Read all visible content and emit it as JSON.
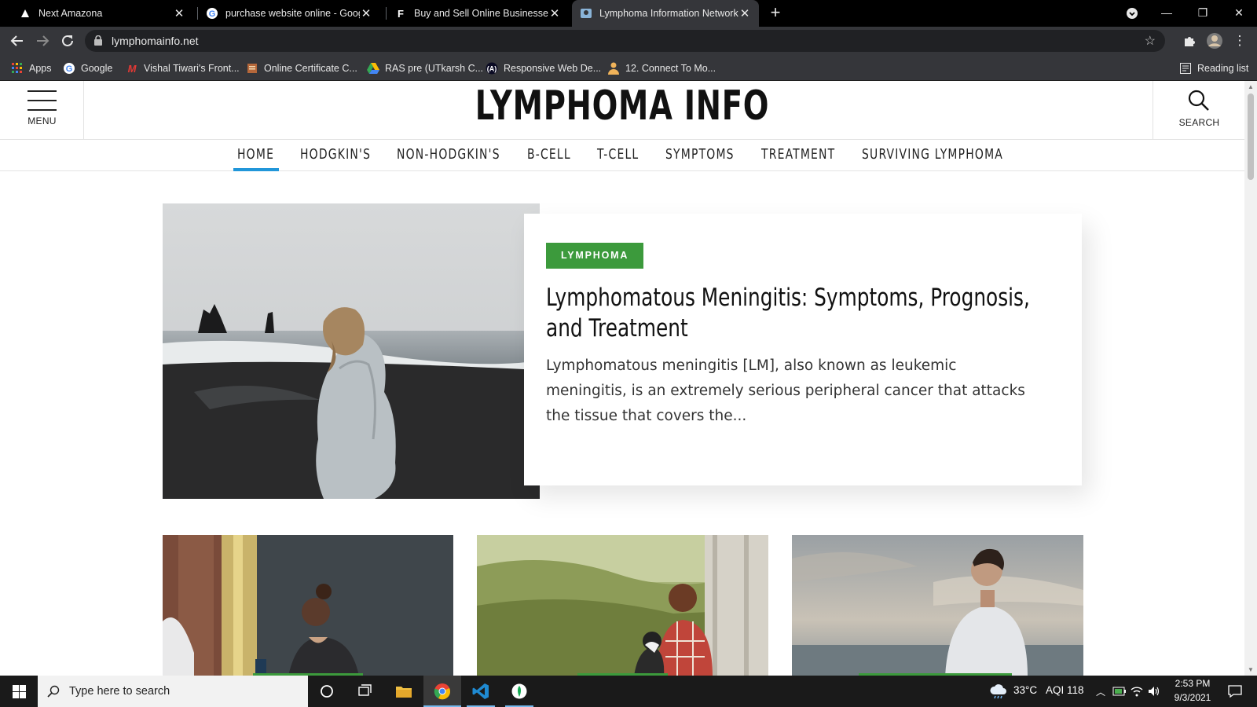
{
  "browser": {
    "tabs": [
      {
        "title": "Next Amazona",
        "favicon": "amazona-favicon",
        "active": false
      },
      {
        "title": "purchase website online - Google",
        "favicon": "google-favicon",
        "active": false
      },
      {
        "title": "Buy and Sell Online Businesses, W",
        "favicon": "flippa-favicon",
        "active": false
      },
      {
        "title": "Lymphoma Information Network",
        "favicon": "lymphoma-favicon",
        "active": true
      }
    ],
    "url": "lymphomainfo.net",
    "bookmarks": [
      {
        "label": "Apps"
      },
      {
        "label": "Google"
      },
      {
        "label": "Vishal Tiwari's Front..."
      },
      {
        "label": "Online Certificate C..."
      },
      {
        "label": "RAS pre (UTkarsh C..."
      },
      {
        "label": "Responsive Web De..."
      },
      {
        "label": "12. Connect To Mo..."
      }
    ],
    "reading_list": "Reading list"
  },
  "site": {
    "menu_label": "MENU",
    "logo": "LYMPHOMA INFO",
    "search_label": "SEARCH",
    "accent": "#2196d9",
    "badge_color": "#3c9a3c",
    "nav": [
      {
        "label": "HOME",
        "active": true
      },
      {
        "label": "HODGKIN'S"
      },
      {
        "label": "NON-HODGKIN'S"
      },
      {
        "label": "B-CELL"
      },
      {
        "label": "T-CELL"
      },
      {
        "label": "SYMPTOMS"
      },
      {
        "label": "TREATMENT"
      },
      {
        "label": "SURVIVING LYMPHOMA"
      }
    ],
    "featured": {
      "category": "LYMPHOMA",
      "title": "Lymphomatous Meningitis: Symptoms, Prognosis, and Treatment",
      "excerpt": "Lymphomatous meningitis [LM], also known as leukemic meningitis, is an extremely serious peripheral cancer that attacks the tissue that covers the..."
    }
  },
  "taskbar": {
    "search_placeholder": "Type here to search",
    "weather": "33°C",
    "aqi": "AQI 118",
    "time": "2:53 PM",
    "date": "9/3/2021"
  }
}
